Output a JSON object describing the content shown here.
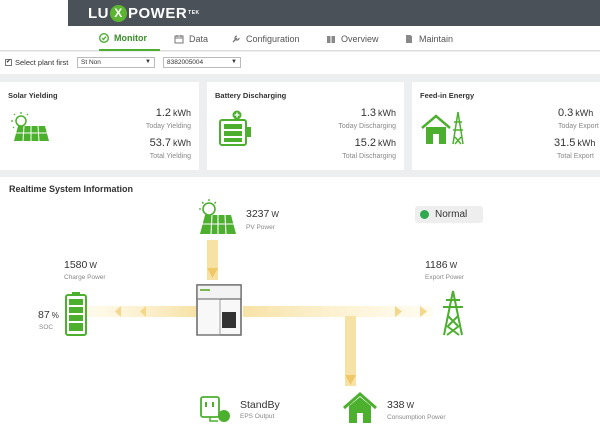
{
  "brand": {
    "logo_pre": "LU",
    "logo_x": "X",
    "logo_post": "POWER",
    "logo_tm": "TEK"
  },
  "nav": {
    "monitor": "Monitor",
    "data": "Data",
    "configuration": "Configuration",
    "overview": "Overview",
    "maintain": "Maintain"
  },
  "filters": {
    "checkbox_label": "Select plant first",
    "plant_value": "St Non",
    "device_value": "8382005004"
  },
  "cards": {
    "solar": {
      "title": "Solar Yielding",
      "today_value": "1.2",
      "today_unit": "kWh",
      "today_label": "Today Yielding",
      "total_value": "53.7",
      "total_unit": "kWh",
      "total_label": "Total Yielding"
    },
    "battery": {
      "title": "Battery Discharging",
      "today_value": "1.3",
      "today_unit": "kWh",
      "today_label": "Today Discharging",
      "total_value": "15.2",
      "total_unit": "kWh",
      "total_label": "Total Discharging"
    },
    "feedin": {
      "title": "Feed-in Energy",
      "today_value": "0.3",
      "today_unit": "kWh",
      "today_label": "Today Export",
      "total_value": "31.5",
      "total_unit": "kWh",
      "total_label": "Total Export"
    }
  },
  "realtime": {
    "title": "Realtime System Information",
    "pv": {
      "value": "3237",
      "unit": "W",
      "label": "PV Power"
    },
    "status": "Normal",
    "charge": {
      "value": "1580",
      "unit": "W",
      "label": "Charge Power"
    },
    "export": {
      "value": "1186",
      "unit": "W",
      "label": "Export Power"
    },
    "soc": {
      "value": "87",
      "unit": "%",
      "label": "SOC"
    },
    "eps": {
      "value": "StandBy",
      "label": "EPS Output"
    },
    "consumption": {
      "value": "338",
      "unit": "W",
      "label": "Consumption Power"
    }
  },
  "colors": {
    "accent": "#4caf2e",
    "header": "#4a5159",
    "flow": "#f7e5b0",
    "status_ok": "#2fa84f"
  }
}
